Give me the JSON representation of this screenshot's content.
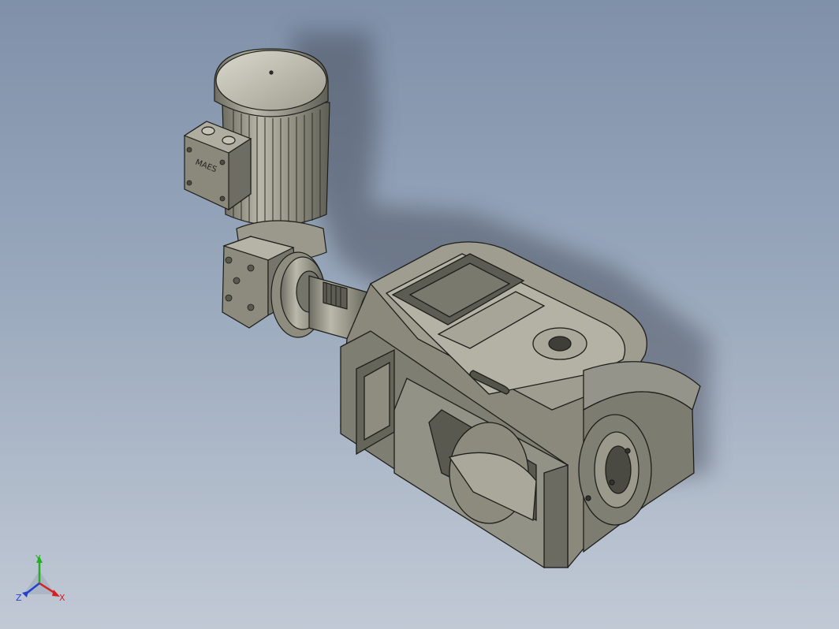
{
  "viewport": {
    "background_top": "#7f90a9",
    "background_bottom": "#c1c9d5",
    "model_color": "#8f8e80",
    "edge_color": "#1e1e1a"
  },
  "model": {
    "nameplate_text": "MAES",
    "parts": [
      "motor-fan-cover",
      "motor-body",
      "terminal-box",
      "gearbox",
      "coupling-flange",
      "drive-shaft",
      "valve-housing",
      "valve-hopper",
      "valve-outlet-frame",
      "valve-end-bore"
    ]
  },
  "triad": {
    "x_label": "X",
    "y_label": "Y",
    "z_label": "Z",
    "x_color": "#d42020",
    "y_color": "#22b022",
    "z_color": "#2040d0"
  }
}
